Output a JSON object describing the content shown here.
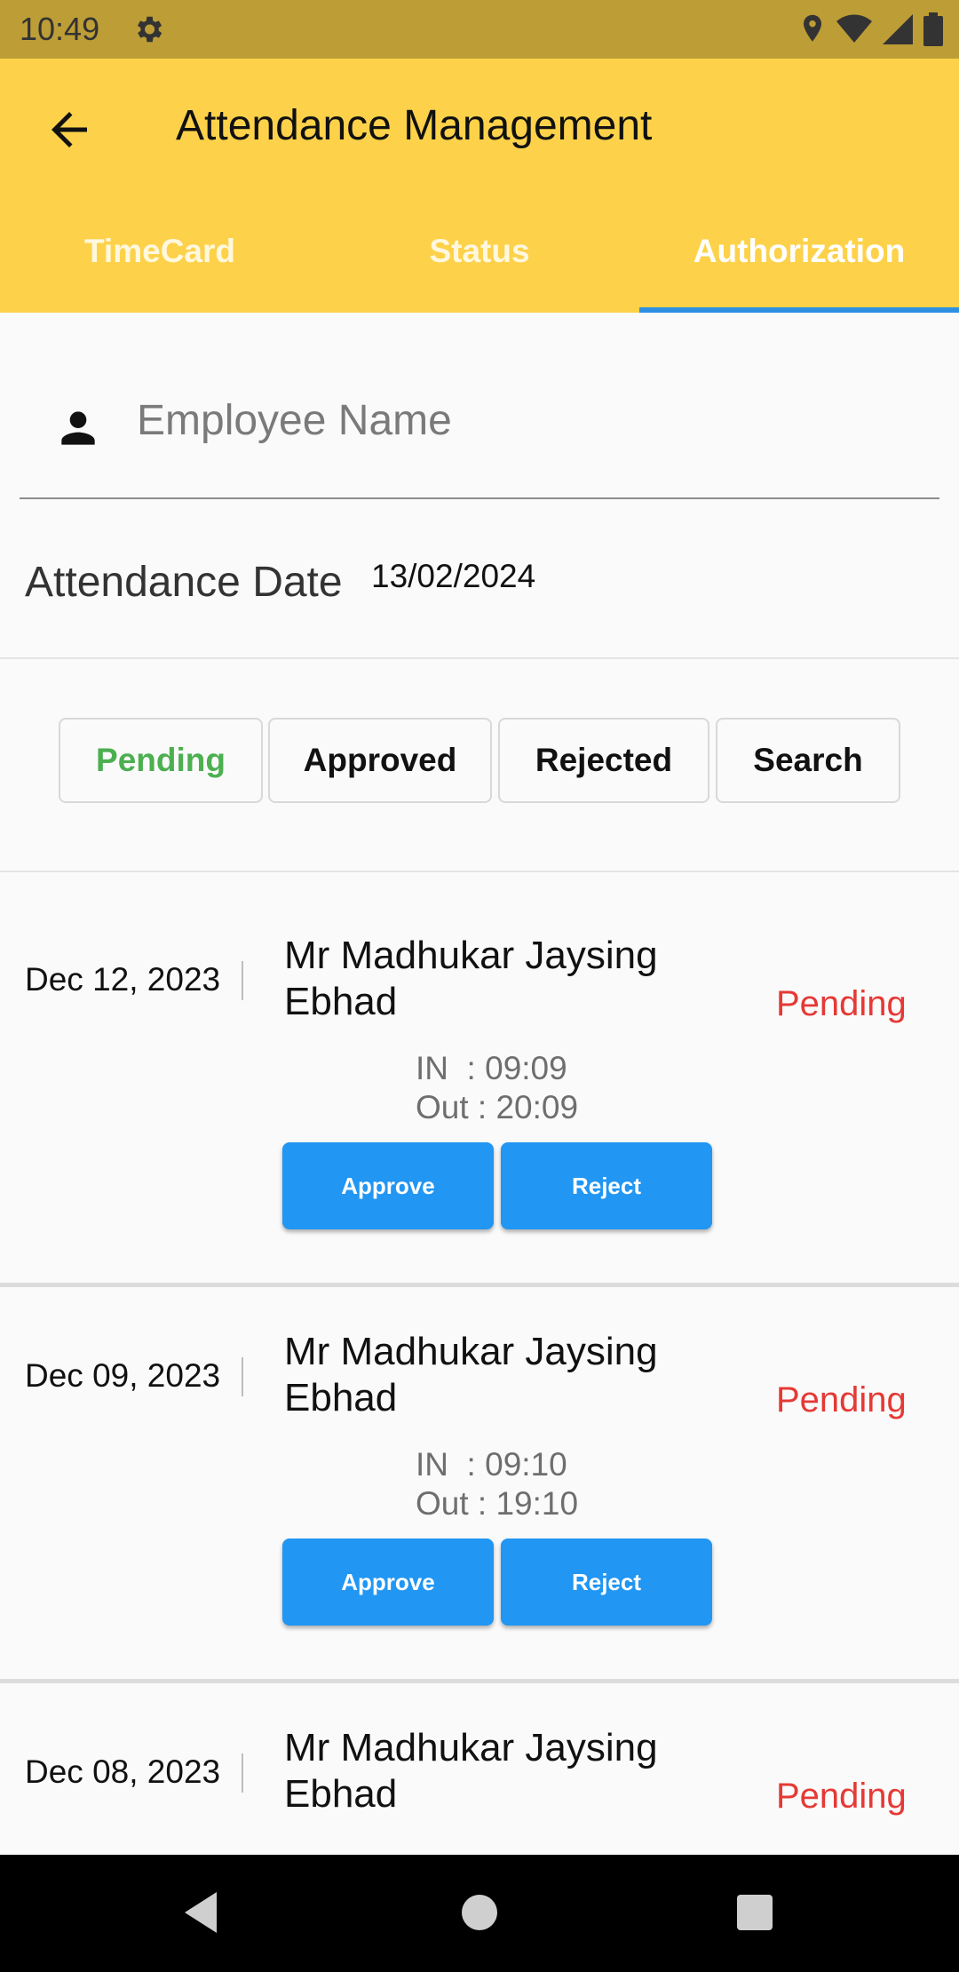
{
  "status_bar": {
    "time": "10:49"
  },
  "app_bar": {
    "title": "Attendance Management"
  },
  "tabs": [
    {
      "label": "TimeCard",
      "active": false
    },
    {
      "label": "Status",
      "active": false
    },
    {
      "label": "Authorization",
      "active": true
    }
  ],
  "employee_field": {
    "placeholder": "Employee Name",
    "value": ""
  },
  "attendance_date": {
    "label": "Attendance Date",
    "value": "13/02/2024"
  },
  "filters": [
    {
      "label": "Pending",
      "active": true
    },
    {
      "label": "Approved",
      "active": false
    },
    {
      "label": "Rejected",
      "active": false
    },
    {
      "label": "Search",
      "active": false
    }
  ],
  "records": [
    {
      "date": "Dec 12, 2023",
      "name": "Mr Madhukar Jaysing Ebhad",
      "status": "Pending",
      "in": "IN  : 09:09",
      "out": "Out : 20:09",
      "approve_label": "Approve",
      "reject_label": "Reject"
    },
    {
      "date": "Dec 09, 2023",
      "name": "Mr Madhukar Jaysing Ebhad",
      "status": "Pending",
      "in": "IN  : 09:10",
      "out": "Out : 19:10",
      "approve_label": "Approve",
      "reject_label": "Reject"
    },
    {
      "date": "Dec 08, 2023",
      "name": "Mr Madhukar Jaysing Ebhad",
      "status": "Pending"
    }
  ],
  "colors": {
    "app_bar": "#fdd24a",
    "status_bar": "#bd9d36",
    "tab_indicator": "#2d90e3",
    "button": "#2196f3",
    "pending": "#e53935",
    "active_filter": "#4caf50"
  }
}
